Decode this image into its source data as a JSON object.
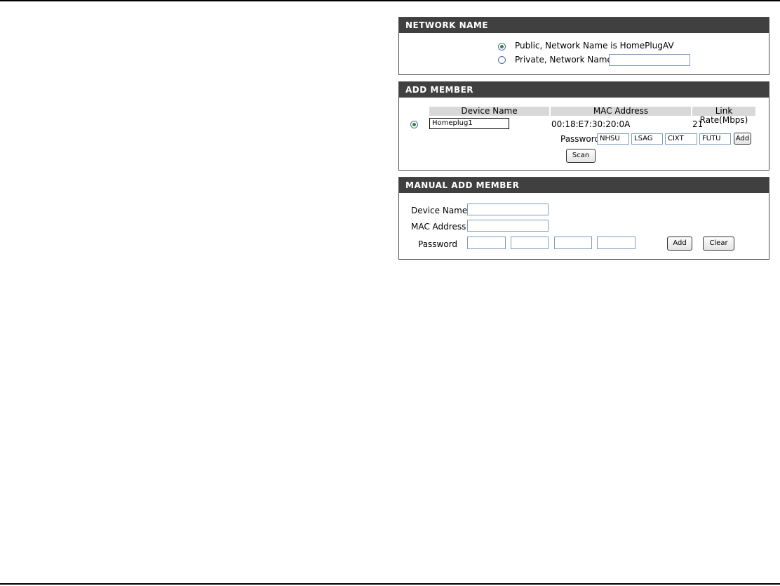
{
  "network_name": {
    "title": "NETWORK NAME",
    "public_label": "Public, Network Name is HomePlugAV",
    "private_label": "Private, Network Name is",
    "private_value": ""
  },
  "add_member": {
    "title": "ADD MEMBER",
    "columns": [
      "Device Name",
      "MAC Address",
      "Link Rate(Mbps)"
    ],
    "row": {
      "device_name": "Homeplug1",
      "mac": "00:18:E7:30:20:0A",
      "link_rate": "21"
    },
    "password_label": "Password",
    "password_parts": [
      "NHSU",
      "LSAG",
      "CIXT",
      "FUTU"
    ],
    "add_label": "Add",
    "scan_label": "Scan"
  },
  "manual_add": {
    "title": "MANUAL ADD MEMBER",
    "device_name_label": "Device Name",
    "mac_label": "MAC Address",
    "password_label": "Password",
    "add_label": "Add",
    "clear_label": "Clear"
  }
}
